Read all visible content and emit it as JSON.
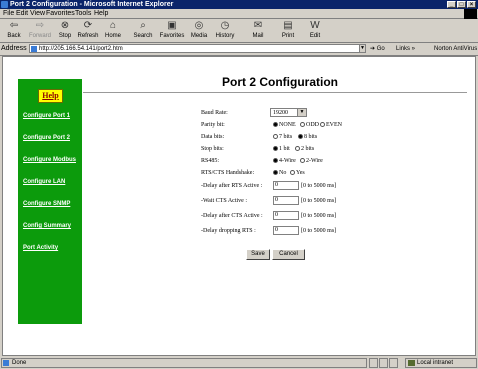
{
  "window": {
    "title": "Port 2 Configuration - Microsoft Internet Explorer"
  },
  "menu": [
    "File",
    "Edit",
    "View",
    "Favorites",
    "Tools",
    "Help"
  ],
  "toolbar": [
    "Back",
    "Forward",
    "Stop",
    "Refresh",
    "Home",
    "Search",
    "Favorites",
    "Media",
    "History",
    "Mail",
    "Print",
    "Edit"
  ],
  "address": {
    "label": "Address",
    "value": "http://205.166.54.141/port2.htm",
    "go": "Go",
    "links": "Links",
    "extra": "Norton AntiVirus"
  },
  "sidebar": {
    "help": "Help",
    "links": [
      "Configure Port 1",
      "Configure Port 2",
      "Configure Modbus",
      "Configure LAN",
      "Configure SNMP",
      "Config Summary",
      "Port Activity"
    ]
  },
  "page": {
    "title": "Port 2 Configuration"
  },
  "form": {
    "baud": {
      "label": "Baud Rate:",
      "value": "19200"
    },
    "parity": {
      "label": "Parity bit:",
      "options": [
        "NONE",
        "ODD",
        "EVEN"
      ],
      "selected": "NONE"
    },
    "databits": {
      "label": "Data bits:",
      "options": [
        "7 bits",
        "8 bits"
      ],
      "selected": "8 bits"
    },
    "stopbits": {
      "label": "Stop bits:",
      "options": [
        "1 bit",
        "2 bits"
      ],
      "selected": "1 bit"
    },
    "rs485": {
      "label": "RS485:",
      "options": [
        "4-Wire",
        "2-Wire"
      ],
      "selected": "4-Wire"
    },
    "handshake": {
      "label": "RTS/CTS Handshake:",
      "options": [
        "No",
        "Yes"
      ],
      "selected": "No"
    },
    "delays": [
      {
        "label": "-Delay after RTS Active :",
        "value": "0",
        "range": "[0 to 5000 ms]"
      },
      {
        "label": "-Wait CTS Active :",
        "value": "0",
        "range": "[0 to 5000 ms]"
      },
      {
        "label": "-Delay after CTS Active :",
        "value": "0",
        "range": "[0 to 5000 ms]"
      },
      {
        "label": "-Delay dropping RTS :",
        "value": "0",
        "range": "[0 to 5000 ms]"
      }
    ],
    "save": "Save",
    "cancel": "Cancel"
  },
  "status": {
    "left": "Done",
    "right": "Local intranet"
  },
  "colors": {
    "sidebar": "#0c9b0c",
    "help_button": "#ffff00",
    "titlebar": "#0a246a"
  }
}
